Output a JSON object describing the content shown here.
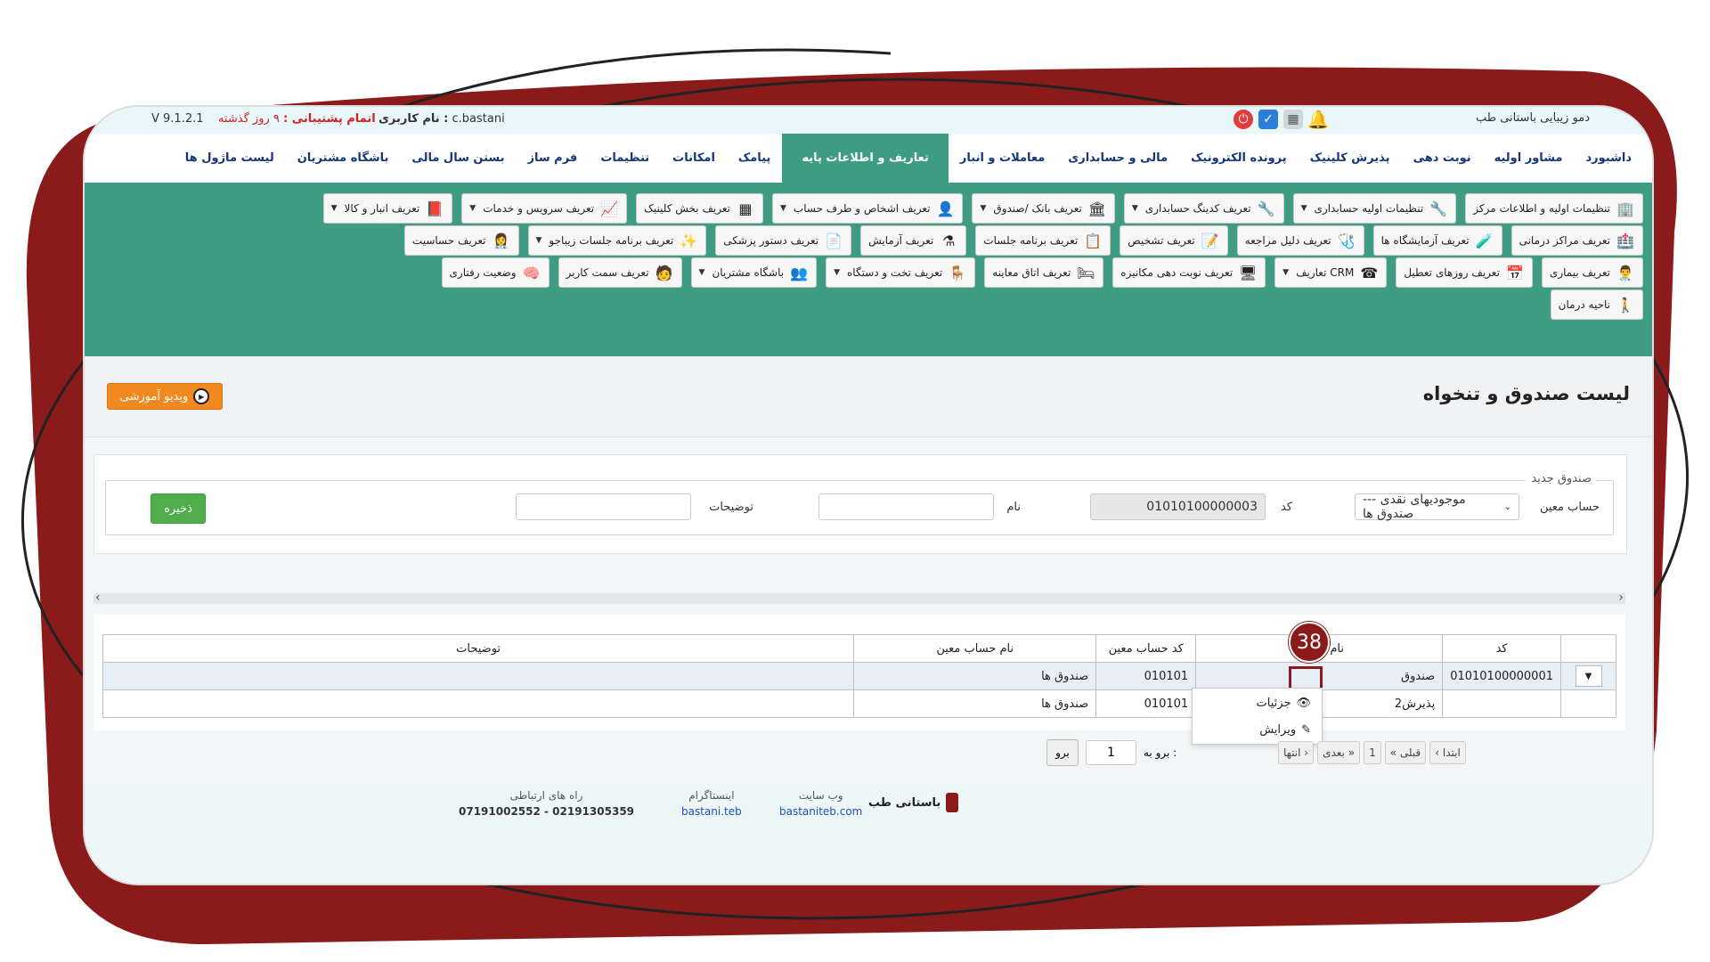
{
  "topbar": {
    "brand": "دمو زیبایی باستانی طب",
    "user_label": "نام کاربری :",
    "username": "c.bastani",
    "support_label": "اتمام پشتیبانی :",
    "support_value": "۹ روز گذشته",
    "version": "V 9.1.2.1"
  },
  "icons": [
    "bell-icon",
    "calendar-icon",
    "calendar-check-icon",
    "power-icon"
  ],
  "menu": {
    "items": [
      "داشبورد",
      "مشاور اولیه",
      "نوبت دهی",
      "پذیرش کلینیک",
      "پرونده الکترونیک",
      "مالی و حسابداری",
      "معاملات و انبار",
      "تعاریف و اطلاعات پایه",
      "پیامک",
      "امکانات",
      "تنظیمات",
      "فرم ساز",
      "بستن سال مالی",
      "باشگاه مشتریان",
      "لیست ماژول ها"
    ],
    "active": "تعاریف و اطلاعات پایه"
  },
  "toolbar": {
    "row1": [
      "تنظیمات اولیه و اطلاعات مرکز",
      "تنظیمات اولیه حسابداری",
      "تعریف کدینگ حسابداری",
      "تعریف بانک /صندوق",
      "تعریف اشخاص و طرف حساب",
      "تعریف بخش کلینیک",
      "تعریف سرویس و خدمات",
      "تعریف انبار و کالا"
    ],
    "row2": [
      "تعریف مراکز درمانی",
      "تعریف آزمایشگاه ها",
      "تعریف دلیل مراجعه",
      "تعریف تشخیص",
      "تعریف برنامه جلسات",
      "تعریف آزمایش",
      "تعریف دستور پزشکی",
      "تعریف برنامه جلسات زیباجو",
      "تعریف حساسیت"
    ],
    "row3": [
      "تعریف بیماری",
      "تعریف روزهای تعطیل",
      "تعاریف CRM",
      "تعریف نوبت دهی مکانیزه",
      "تعریف اتاق معاینه",
      "تعریف تخت و دستگاه",
      "باشگاه مشتریان",
      "تعریف سمت کاربر",
      "وضعیت رفتاری"
    ],
    "row4": [
      "ناحیه درمان"
    ]
  },
  "page": {
    "title": "لیست صندوق و تنخواه",
    "video_button": "ویدیو آموزشی"
  },
  "form": {
    "legend": "صندوق جدید",
    "account_label": "حساب معین",
    "account_value": "موجودیهای نقدی --- صندوق ها",
    "code_label": "کد",
    "code_value": "01010100000003",
    "name_label": "نام",
    "name_value": "",
    "desc_label": "توضیحات",
    "desc_value": "",
    "save_label": "ذخیره"
  },
  "table": {
    "headers": [
      "کد",
      "نام حساب",
      "کد حساب معین",
      "نام حساب معین",
      "توضیحات"
    ],
    "rows": [
      [
        "01010100000001",
        "صندوق",
        "010101",
        "صندوق ها",
        ""
      ],
      [
        "",
        "پذیرش2",
        "010101",
        "صندوق ها",
        ""
      ]
    ]
  },
  "badge": "38",
  "dropdown": {
    "items": [
      "جزئیات",
      "ویرایش"
    ]
  },
  "pager": {
    "first": "‹ ابتدا",
    "prev": "« قبلی",
    "page": "1",
    "next": "بعدی »",
    "last": "انتها ›",
    "goto_label": "برو به :",
    "goto_value": "1",
    "go": "برو"
  },
  "footer": {
    "logo": "باستانی طب",
    "website_label": "وب سایت",
    "website": "bastaniteb.com",
    "instagram_label": "اینستاگرام",
    "instagram": "bastani.teb",
    "contact_label": "راه های ارتباطی",
    "contact": "07191002552 - 02191305359"
  },
  "colors": {
    "green": "#3e9c82",
    "dark_red": "#8b1a1a",
    "orange": "#f08a20",
    "menu_text": "#14367a"
  }
}
